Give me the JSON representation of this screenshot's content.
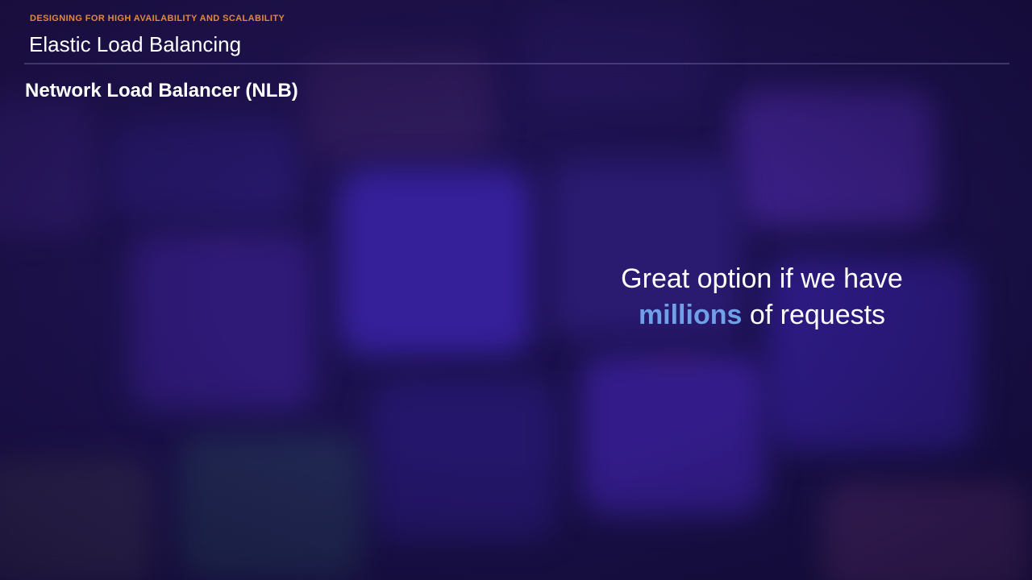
{
  "header": {
    "section_label": "DESIGNING FOR HIGH AVAILABILITY AND SCALABILITY",
    "title": "Elastic Load Balancing"
  },
  "slide": {
    "subtitle": "Network Load Balancer (NLB)",
    "callout": {
      "line1": "Great option if we have",
      "highlight": "millions",
      "line2_rest": " of requests"
    }
  },
  "colors": {
    "section_label": "#e08a3c",
    "highlight": "#6fa0e8",
    "background": "#1d1250",
    "text": "#ffffff"
  }
}
